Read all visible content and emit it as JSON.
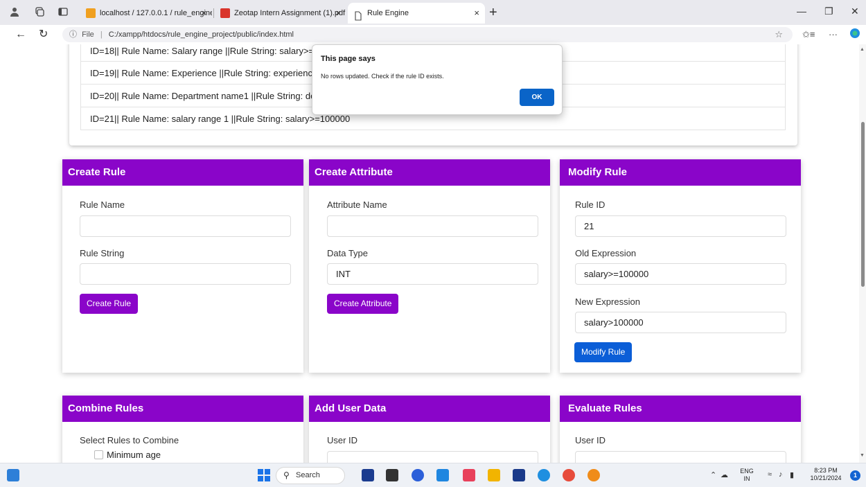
{
  "browser": {
    "tabs": [
      {
        "label": "localhost / 127.0.0.1 / rule_engine",
        "close": "×"
      },
      {
        "label": "Zeotap Intern Assignment (1).pdf",
        "close": "×"
      },
      {
        "label": "Rule Engine",
        "close": "×"
      }
    ],
    "new_tab": "+",
    "url_scheme_label": "File",
    "url": "C:/xampp/htdocs/rule_engine_project/public/index.html"
  },
  "rules_list": [
    "ID=18|| Rule Name: Salary range ||Rule String: salary>=6",
    "ID=19|| Rule Name: Experience ||Rule String: experience>",
    "ID=20|| Rule Name: Department name1 ||Rule String: de",
    "ID=21|| Rule Name: salary range 1 ||Rule String: salary>=100000"
  ],
  "create_rule": {
    "title": "Create Rule",
    "name_label": "Rule Name",
    "name_value": "",
    "string_label": "Rule String",
    "string_value": "",
    "button": "Create Rule"
  },
  "create_attribute": {
    "title": "Create Attribute",
    "name_label": "Attribute Name",
    "name_value": "",
    "type_label": "Data Type",
    "type_value": "INT",
    "button": "Create Attribute"
  },
  "modify_rule": {
    "title": "Modify Rule",
    "id_label": "Rule ID",
    "id_value": "21",
    "old_label": "Old Expression",
    "old_value": "salary>=100000",
    "new_label": "New Expression",
    "new_value": "salary>100000",
    "button": "Modify Rule"
  },
  "combine_rules": {
    "title": "Combine Rules",
    "select_label": "Select Rules to Combine",
    "options": [
      "Minimum age"
    ]
  },
  "add_user_data": {
    "title": "Add User Data",
    "user_label": "User ID"
  },
  "evaluate_rules": {
    "title": "Evaluate Rules",
    "user_label": "User ID"
  },
  "dialog": {
    "title": "This page says",
    "message": "No rows updated. Check if the rule ID exists.",
    "ok": "OK"
  },
  "taskbar": {
    "search": "Search",
    "lang": "ENG",
    "region": "IN",
    "time": "8:23 PM",
    "date": "10/21/2024",
    "notifications": "1"
  },
  "colors": {
    "panel_header": "#8a05c9",
    "primary_button": "#0b5ed7",
    "dialog_ok": "#0a64c8"
  }
}
